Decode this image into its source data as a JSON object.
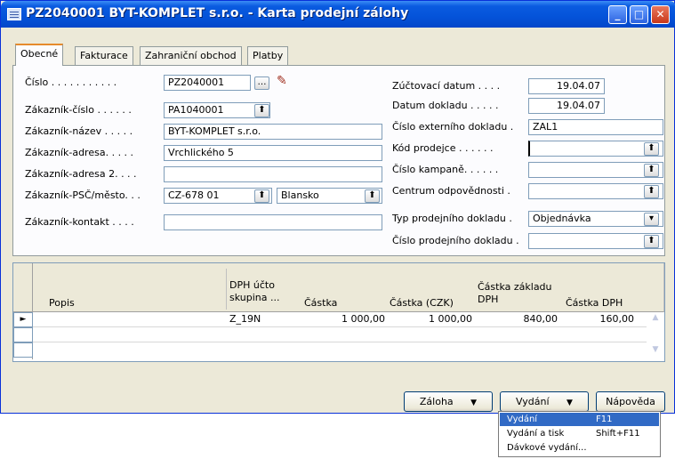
{
  "window": {
    "title": "PZ2040001 BYT-KOMPLET s.r.o. - Karta prodejní zálohy",
    "min_icon": "minimize-icon",
    "max_icon": "maximize-icon",
    "close_icon": "close-icon"
  },
  "tabs": [
    "Obecné",
    "Fakturace",
    "Zahraniční obchod",
    "Platby"
  ],
  "left": {
    "cislo_label": "Číslo . . . . . . . . . . .",
    "cislo_value": "PZ2040001",
    "zak_cislo_label": "Zákazník-číslo . . . . . .",
    "zak_cislo_value": "PA1040001",
    "zak_nazev_label": "Zákazník-název . . . . .",
    "zak_nazev_value": "BYT-KOMPLET s.r.o.",
    "zak_adresa_label": "Zákazník-adresa. . . . .",
    "zak_adresa_value": "Vrchlického 5",
    "zak_adresa2_label": "Zákazník-adresa 2. . . .",
    "zak_adresa2_value": "",
    "zak_psc_label": "Zákazník-PSČ/město. . .",
    "zak_psc_value": "CZ-678 01",
    "zak_mesto_value": "Blansko",
    "zak_kontakt_label": "Zákazník-kontakt . . . .",
    "zak_kontakt_value": ""
  },
  "right": {
    "zuct_label": "Zúčtovací datum . . . .",
    "zuct_value": "19.04.07",
    "datum_label": "Datum dokladu . . . . .",
    "datum_value": "19.04.07",
    "ext_label": "Číslo externího dokladu .",
    "ext_value": "ZAL1",
    "prodejce_label": "Kód prodejce . . . . . .",
    "prodejce_value": "",
    "kampan_label": "Číslo kampaně. . . . . .",
    "kampan_value": "",
    "centrum_label": "Centrum odpovědnosti .",
    "centrum_value": "",
    "typ_label": "Typ prodejního dokladu .",
    "typ_value": "Objednávka",
    "cislo_prod_label": "Číslo prodejního dokladu .",
    "cislo_prod_value": ""
  },
  "grid": {
    "headers": {
      "popis": "Popis",
      "dph1": "DPH účto",
      "dph2": "skupina ...",
      "castka": "Částka",
      "castka_czk": "Částka (CZK)",
      "zaklad1": "Částka základu",
      "zaklad2": "DPH",
      "castka_dph": "Částka DPH"
    },
    "row": {
      "popis": "",
      "dph": "Z_19N",
      "castka": "1 000,00",
      "castka_czk": "1 000,00",
      "zaklad": "840,00",
      "castka_dph": "160,00"
    }
  },
  "buttons": {
    "zaloha": "Záloha",
    "vydani": "Vydání",
    "napoveda": "Nápověda"
  },
  "menu": [
    {
      "label": "Vydání",
      "key": "F11"
    },
    {
      "label": "Vydání a tisk",
      "key": "Shift+F11"
    },
    {
      "label": "Dávkové vydání...",
      "key": ""
    }
  ]
}
